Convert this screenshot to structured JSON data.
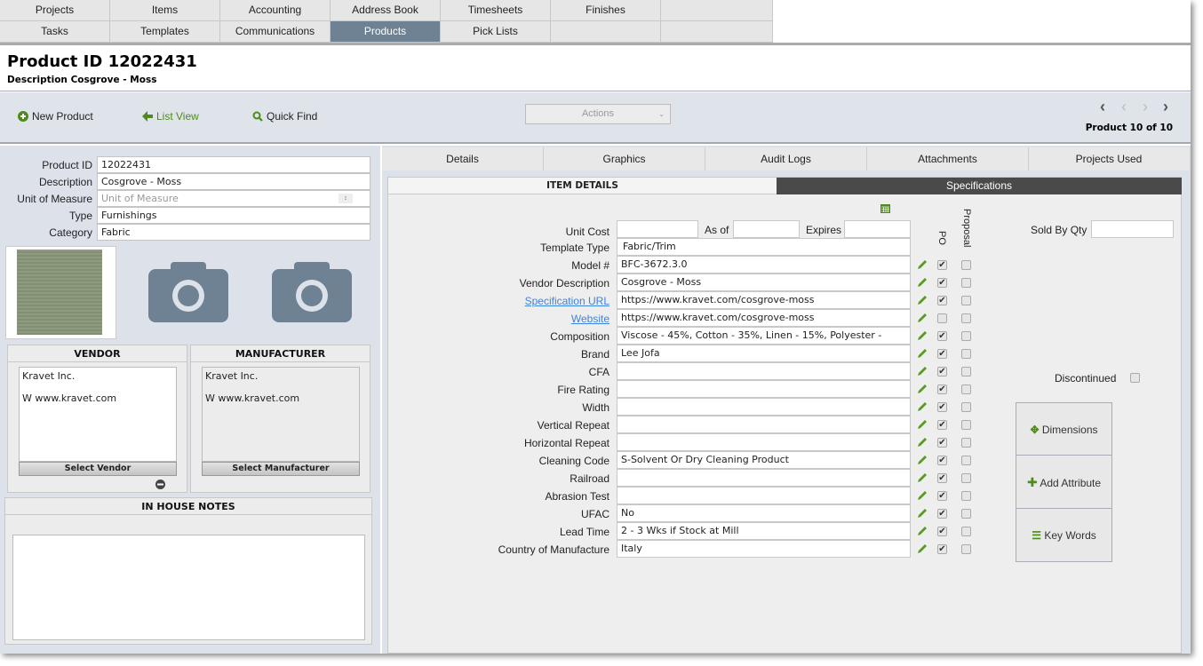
{
  "nav": {
    "row1": [
      "Projects",
      "Items",
      "Accounting",
      "Address Book",
      "Timesheets",
      "Finishes",
      ""
    ],
    "row2": [
      "Tasks",
      "Templates",
      "Communications",
      "Products",
      "Pick Lists",
      "",
      ""
    ],
    "active": "Products"
  },
  "header": {
    "title": "Product ID 12022431",
    "subtitle": "Description Cosgrove - Moss"
  },
  "toolbar": {
    "new_product": "New Product",
    "list_view": "List View",
    "quick_find": "Quick Find",
    "actions": "Actions",
    "pager": "Product 10 of 10"
  },
  "colors": {
    "accent_green": "#4e8a1e",
    "nav_active": "#6e8294",
    "camera": "#6e8294"
  },
  "left": {
    "fields": [
      {
        "label": "Product ID",
        "value": "12022431"
      },
      {
        "label": "Description",
        "value": "Cosgrove - Moss"
      },
      {
        "label": "Unit of Measure",
        "placeholder": "Unit of Measure"
      },
      {
        "label": "Type",
        "value": "Furnishings"
      },
      {
        "label": "Category",
        "value": "Fabric"
      }
    ],
    "vendor": {
      "title": "VENDOR",
      "name": "Kravet Inc.",
      "web": "W  www.kravet.com",
      "button": "Select Vendor"
    },
    "manufacturer": {
      "title": "MANUFACTURER",
      "name": "Kravet Inc.",
      "web": "W  www.kravet.com",
      "button": "Select Manufacturer"
    },
    "notes": {
      "title": "IN HOUSE NOTES",
      "value": ""
    }
  },
  "tabs": [
    "Details",
    "Graphics",
    "Audit Logs",
    "Attachments",
    "Projects Used"
  ],
  "subtabs": {
    "item_details": "ITEM DETAILS",
    "specifications": "Specifications"
  },
  "form": {
    "unit_cost_label": "Unit Cost",
    "as_of_label": "As of",
    "expires_label": "Expires",
    "template_label": "Template Type",
    "template_value": "Fabric/Trim",
    "po_label": "PO",
    "proposal_label": "Proposal",
    "sold_by_qty_label": "Sold By Qty",
    "discontinued_label": "Discontinued",
    "rows": [
      {
        "label": "Model #",
        "value": "BFC-3672.3.0",
        "po": true,
        "proposal": false
      },
      {
        "label": "Vendor Description",
        "value": "Cosgrove - Moss",
        "po": true,
        "proposal": false
      },
      {
        "label": "Specification URL",
        "value": "https://www.kravet.com/cosgrove-moss",
        "po": true,
        "proposal": false,
        "link": true
      },
      {
        "label": "Website",
        "value": "https://www.kravet.com/cosgrove-moss",
        "po": false,
        "proposal": false,
        "link": true
      },
      {
        "label": "Composition",
        "value": "Viscose - 45%, Cotton - 35%, Linen - 15%, Polyester -",
        "po": true,
        "proposal": false
      },
      {
        "label": "Brand",
        "value": "Lee Jofa",
        "po": true,
        "proposal": false
      },
      {
        "label": "CFA",
        "value": "",
        "po": true,
        "proposal": false
      },
      {
        "label": "Fire Rating",
        "value": "",
        "po": true,
        "proposal": false
      },
      {
        "label": "Width",
        "value": "",
        "po": true,
        "proposal": false
      },
      {
        "label": "Vertical Repeat",
        "value": "",
        "po": true,
        "proposal": false
      },
      {
        "label": "Horizontal Repeat",
        "value": "",
        "po": true,
        "proposal": false
      },
      {
        "label": "Cleaning Code",
        "value": "S-Solvent Or Dry Cleaning Product",
        "po": true,
        "proposal": false
      },
      {
        "label": "Railroad",
        "value": "",
        "po": true,
        "proposal": false
      },
      {
        "label": "Abrasion Test",
        "value": "",
        "po": true,
        "proposal": false
      },
      {
        "label": "UFAC",
        "value": "No",
        "po": true,
        "proposal": false
      },
      {
        "label": "Lead Time",
        "value": "2 - 3 Wks if Stock at Mill",
        "po": true,
        "proposal": false
      },
      {
        "label": "Country of Manufacture",
        "value": "Italy",
        "po": true,
        "proposal": false
      }
    ]
  },
  "side_buttons": {
    "dimensions": "Dimensions",
    "add_attribute": "Add Attribute",
    "key_words": "Key Words"
  }
}
